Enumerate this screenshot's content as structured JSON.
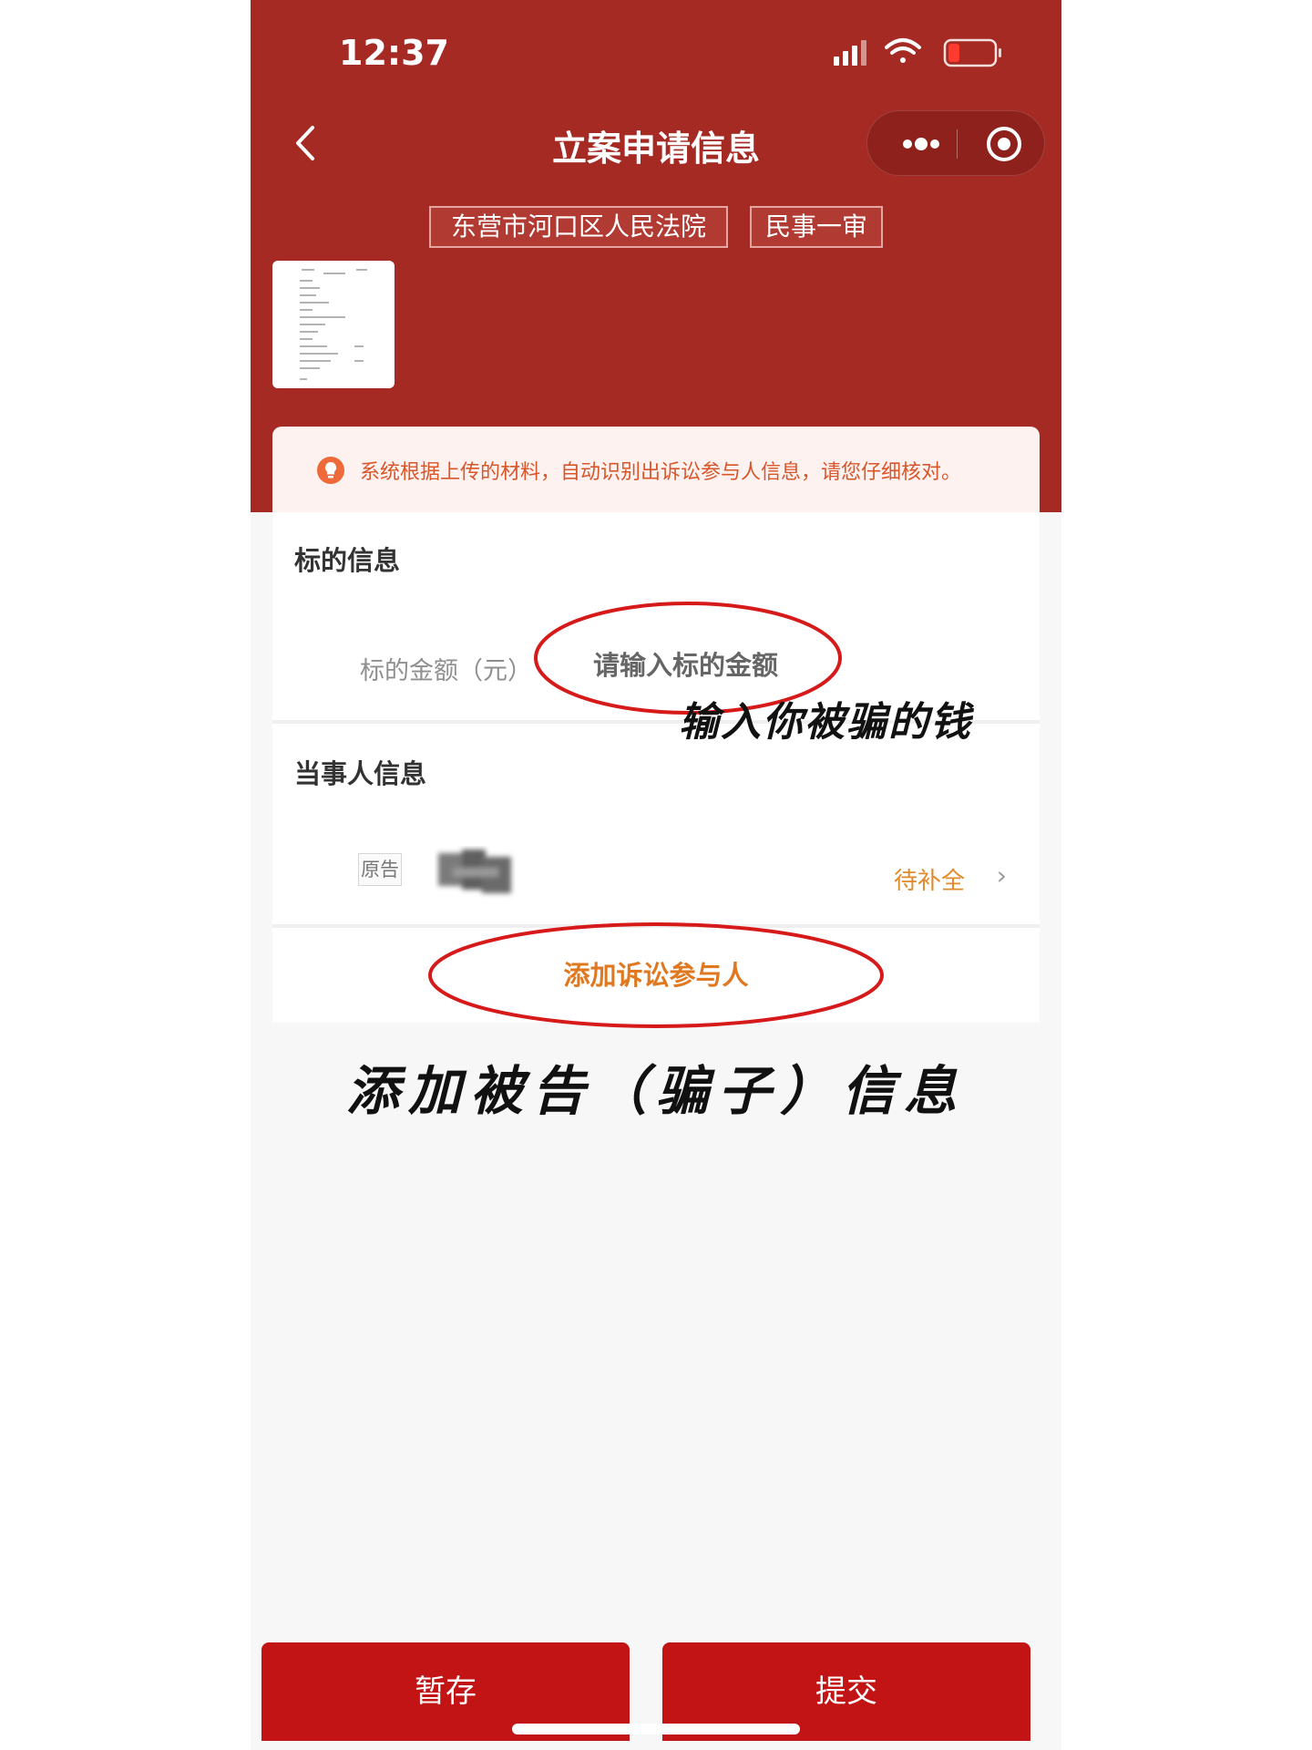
{
  "status_bar": {
    "time": "12:37"
  },
  "nav": {
    "title": "立案申请信息"
  },
  "tags": {
    "court": "东营市河口区人民法院",
    "case_type": "民事一审"
  },
  "notice": {
    "text": "系统根据上传的材料，自动识别出诉讼参与人信息，请您仔细核对。"
  },
  "subject": {
    "title": "标的信息",
    "amount_label": "标的金额（元）",
    "amount_placeholder": "请输入标的金额"
  },
  "parties": {
    "title": "当事人信息",
    "role": "原告",
    "status": "待补全"
  },
  "add_party_label": "添加诉讼参与人",
  "annotations": {
    "enter_amount": "输入你被骗的钱",
    "add_defendant": "添加被告（骗子）信息"
  },
  "footer": {
    "save_label": "暂存",
    "submit_label": "提交"
  },
  "colors": {
    "header": "#a52a24",
    "accent": "#e0781f",
    "button": "#c21414",
    "circle": "#d61a1a"
  }
}
